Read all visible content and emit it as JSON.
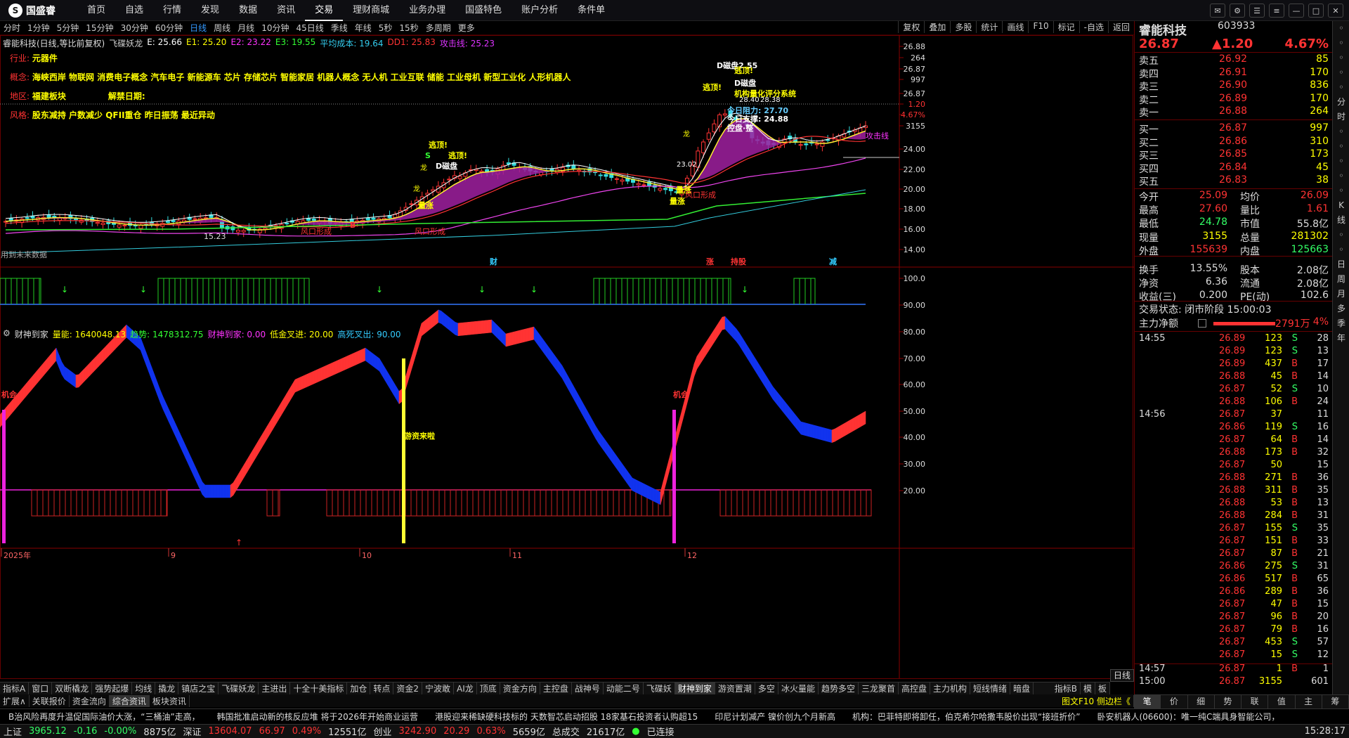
{
  "nav": {
    "logo": "国盛睿",
    "items": [
      "首页",
      "自选",
      "行情",
      "发现",
      "数据",
      "资讯",
      "交易",
      "理财商城",
      "业务办理",
      "国盛特色",
      "账户分析",
      "条件单"
    ],
    "active": 6
  },
  "period": {
    "items": [
      "分时",
      "1分钟",
      "5分钟",
      "15分钟",
      "30分钟",
      "60分钟",
      "日线",
      "周线",
      "月线",
      "10分钟",
      "45日线",
      "季线",
      "年线",
      "5秒",
      "15秒",
      "多周期",
      "更多"
    ],
    "active": 6,
    "tools": [
      "复权",
      "叠加",
      "多股",
      "统计",
      "画线",
      "F10",
      "标记",
      "-自选",
      "返回"
    ]
  },
  "main": {
    "title": {
      "name": "睿能科技(日线,等比前复权)",
      "ind": "飞碟妖龙",
      "e": "E: 25.66",
      "e1": "E1: 25.20",
      "e2": "E2: 23.22",
      "e3": "E3: 19.55",
      "avg": "平均成本: 19.64",
      "dd1": "DD1: 25.83",
      "attack": "攻击线: 25.23"
    },
    "info": {
      "industry_label": "行业:",
      "industry": "元器件",
      "concept_label": "概念:",
      "concept": "海峡西岸 物联网 消费电子概念 汽车电子 新能源车 芯片 存储芯片 智能家居 机器人概念 无人机 工业互联 储能 工业母机 新型工业化 人形机器人",
      "region_label": "地区:",
      "region": "福建板块",
      "unlock_label": "解禁日期:",
      "style_label": "风格:",
      "style": "股东减持 户数减少 QFII重仓 昨日振荡 最近异动"
    },
    "price_axis": [
      "26.88",
      "264",
      "26.87",
      "997",
      "26.87",
      "1.20",
      "4.67%",
      "3155",
      "24.00",
      "22.00",
      "20.00",
      "18.00",
      "16.00",
      "14.00"
    ],
    "annotations": {
      "low": "15.23",
      "d_high": "D磁盘2.55",
      "escape": "逃顶!",
      "d_disk": "D磁盘",
      "system": "机构量化评分系统",
      "today_pressure": "今日阻力: 27.70",
      "today_support": "今日支撑: 24.88",
      "control": "控盘·整",
      "attack_line": "攻击线",
      "p2840": "28.40",
      "p2838": "28.38",
      "p2302": "23.02",
      "rise": "量涨",
      "gap": "风口形成",
      "dragon": "龙",
      "buy": "B",
      "sell": "S",
      "nodata": "用到未来数据"
    },
    "markers": [
      "财",
      "涨",
      "持股",
      "减"
    ]
  },
  "sub": {
    "title": {
      "name": "财神到家",
      "liang": "量能: 1640048.13",
      "trend": "趋势: 1478312.75",
      "god": "财神到家: 0.00",
      "low": "低金叉进: 20.00",
      "high": "高死叉出: 90.00"
    },
    "axis": [
      "100.0",
      "90.00",
      "80.00",
      "70.00",
      "60.00",
      "50.00",
      "40.00",
      "30.00",
      "20.00"
    ],
    "labels": {
      "jihui": "机会",
      "jihui2": "机会",
      "youzi": "游资来啦"
    }
  },
  "dates": [
    "2025年",
    "9",
    "10",
    "11",
    "12"
  ],
  "tabs1": {
    "items": [
      "指标A",
      "窗口",
      "双断橇龙",
      "强势起爆",
      "均线",
      "撬龙",
      "镇店之宝",
      "飞碟妖龙",
      "主进出",
      "十全十美指标",
      "加仓",
      "转点",
      "资金2",
      "宁波敢",
      "AI龙",
      "顶底",
      "资金方向",
      "主控盘",
      "战神号",
      "动能二号",
      "飞碟妖",
      "财神到家",
      "游资置潮",
      "多空",
      "冰火量能",
      "趋势多空",
      "三龙聚首",
      "高控盘",
      "主力机构",
      "短线情绪",
      "暗盘"
    ],
    "active": 21,
    "right": [
      "指标B",
      "模",
      "板"
    ]
  },
  "tabs2": {
    "items": [
      "扩展∧",
      "关联报价",
      "资金流向",
      "综合资讯",
      "板块资讯"
    ],
    "active": 3,
    "right": "图文F10 侧边栏《"
  },
  "ticker": [
    "B治风险再度升温促国际油价大涨，“三桶油”走高，",
    "韩国批准启动新的核反应堆 将于2026年开始商业运营",
    "港股迎来稀缺硬科技标的 天数智芯启动招股 18家基石投资者认购超15",
    "印尼计划减产 镍价创九个月新高",
    "机构：巴菲特即将卸任，伯克希尔哈撒韦股价出现“接班折价”",
    "卧安机器人(06600)：唯一纯C端具身智能公司，"
  ],
  "status": {
    "sh_label": "上证",
    "sh": "3965.12",
    "sh_chg": "-0.16",
    "sh_pct": "-0.00%",
    "sh_amt": "8875亿",
    "sz_label": "深证",
    "sz": "13604.07",
    "sz_chg": "66.97",
    "sz_pct": "0.49%",
    "sz_amt": "12551亿",
    "cy_label": "创业",
    "cy": "3242.90",
    "cy_chg": "20.29",
    "cy_pct": "0.63%",
    "cy_amt": "5659亿",
    "total_label": "总成交",
    "total": "21617亿",
    "conn": "已连接",
    "time": "15:28:17"
  },
  "quote": {
    "name": "睿能科技",
    "code": "603933",
    "price": "26.87",
    "chg": "▲1.20",
    "pct": "4.67%",
    "sells": [
      [
        "卖五",
        "26.92",
        "85"
      ],
      [
        "卖四",
        "26.91",
        "170"
      ],
      [
        "卖三",
        "26.90",
        "836"
      ],
      [
        "卖二",
        "26.89",
        "170"
      ],
      [
        "卖一",
        "26.88",
        "264"
      ]
    ],
    "buys": [
      [
        "买一",
        "26.87",
        "997"
      ],
      [
        "买二",
        "26.86",
        "310"
      ],
      [
        "买三",
        "26.85",
        "173"
      ],
      [
        "买四",
        "26.84",
        "45"
      ],
      [
        "买五",
        "26.83",
        "38"
      ]
    ],
    "stats": [
      [
        "今开",
        "25.09",
        "均价",
        "26.09"
      ],
      [
        "最高",
        "27.60",
        "量比",
        "1.61"
      ],
      [
        "最低",
        "24.78",
        "市值",
        "55.8亿"
      ],
      [
        "现量",
        "3155",
        "总量",
        "281302"
      ],
      [
        "外盘",
        "155639",
        "内盘",
        "125663"
      ],
      [
        "换手",
        "13.55%",
        "股本",
        "2.08亿"
      ],
      [
        "净资",
        "6.36",
        "流通",
        "2.08亿"
      ],
      [
        "收益(三)",
        "0.200",
        "PE(动)",
        "102.6"
      ]
    ],
    "state": "交易状态: 闭市阶段 15:00:03",
    "net_label": "主力净额",
    "net": "2791万",
    "net_pct": "4%",
    "ticks": [
      [
        "14:55",
        "26.89",
        "123",
        "S",
        "28"
      ],
      [
        "",
        "26.89",
        "123",
        "S",
        "13"
      ],
      [
        "",
        "26.89",
        "437",
        "B",
        "17"
      ],
      [
        "",
        "26.88",
        "45",
        "B",
        "14"
      ],
      [
        "",
        "26.87",
        "52",
        "S",
        "10"
      ],
      [
        "",
        "26.88",
        "106",
        "B",
        "24"
      ],
      [
        "14:56",
        "26.87",
        "37",
        "",
        "11"
      ],
      [
        "",
        "26.86",
        "119",
        "S",
        "16"
      ],
      [
        "",
        "26.87",
        "64",
        "B",
        "14"
      ],
      [
        "",
        "26.88",
        "173",
        "B",
        "32"
      ],
      [
        "",
        "26.87",
        "50",
        "",
        "15"
      ],
      [
        "",
        "26.88",
        "271",
        "B",
        "36"
      ],
      [
        "",
        "26.88",
        "311",
        "B",
        "35"
      ],
      [
        "",
        "26.88",
        "53",
        "B",
        "13"
      ],
      [
        "",
        "26.88",
        "284",
        "B",
        "31"
      ],
      [
        "",
        "26.87",
        "155",
        "S",
        "35"
      ],
      [
        "",
        "26.87",
        "151",
        "B",
        "33"
      ],
      [
        "",
        "26.87",
        "87",
        "B",
        "21"
      ],
      [
        "",
        "26.86",
        "275",
        "S",
        "31"
      ],
      [
        "",
        "26.86",
        "517",
        "B",
        "65"
      ],
      [
        "",
        "26.86",
        "289",
        "B",
        "36"
      ],
      [
        "",
        "26.87",
        "47",
        "B",
        "15"
      ],
      [
        "",
        "26.87",
        "96",
        "B",
        "20"
      ],
      [
        "",
        "26.87",
        "79",
        "B",
        "16"
      ],
      [
        "",
        "26.87",
        "453",
        "S",
        "57"
      ],
      [
        "",
        "26.87",
        "15",
        "S",
        "12"
      ],
      [
        "14:57",
        "26.87",
        "1",
        "B",
        "1"
      ],
      [
        "15:00",
        "26.87",
        "3155",
        "",
        "601"
      ]
    ]
  },
  "side_buttons": [
    "",
    "",
    "",
    "",
    "",
    "分",
    "时",
    "",
    "",
    "",
    "",
    "",
    "K",
    "线",
    "",
    "",
    "日",
    "周",
    "月",
    "多",
    "季",
    "年"
  ],
  "right_tabs": [
    "笔",
    "价",
    "细",
    "势",
    "联",
    "值",
    "主",
    "筹"
  ],
  "right_tabs_active": 0,
  "period_label": "日线",
  "colors": {
    "up": "#ff3333",
    "down": "#00cc66",
    "blue": "#1133ee",
    "yellow": "#ffff00",
    "magenta": "#ee22dd",
    "cyan": "#33ccdd"
  }
}
